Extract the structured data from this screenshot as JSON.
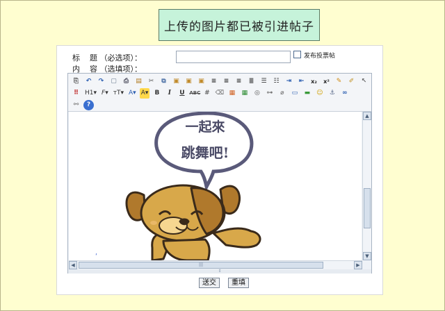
{
  "banner": {
    "text": "上传的图片都已被引进帖子"
  },
  "form": {
    "title_label": "标    题 （必选项）：",
    "content_label": "内    容 （选填项）：",
    "title_value": "",
    "poll_label": "发布投票帖"
  },
  "toolbar": {
    "h1": "H1",
    "bold": "B",
    "italic": "I",
    "underline": "U"
  },
  "image": {
    "line1": "一起來",
    "line2": "跳舞吧!"
  },
  "buttons": {
    "submit": "送交",
    "reset": "重填"
  },
  "colors": {
    "page_bg": "#fffed0",
    "banner_bg": "#c6f3da",
    "editor_border": "#a7b3c2",
    "dog_fur": "#d8a84a",
    "dog_patch": "#b0792c"
  }
}
